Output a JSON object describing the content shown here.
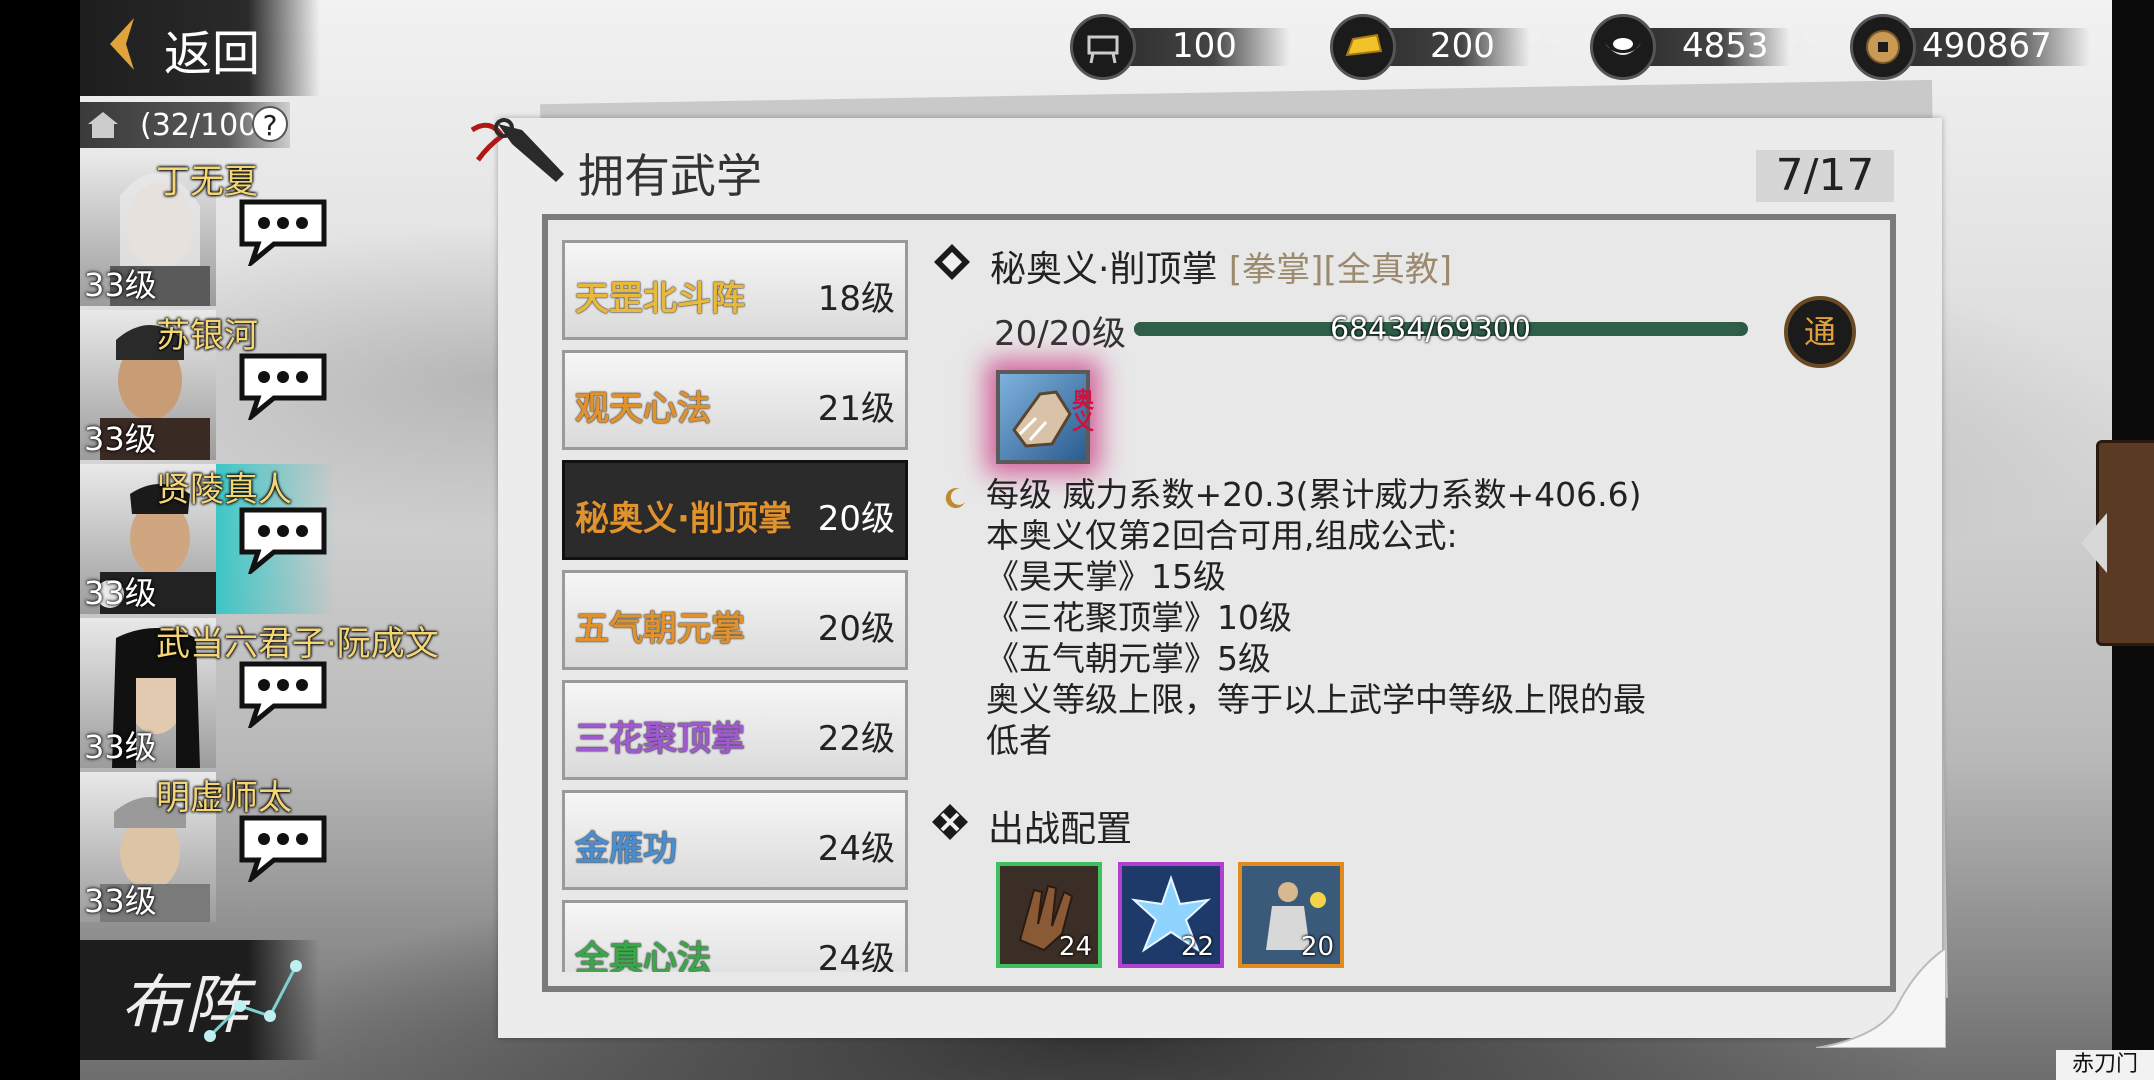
{
  "top": {
    "back_label": "返回",
    "resources": [
      {
        "icon": "cart-icon",
        "value": "100",
        "has_plus": false
      },
      {
        "icon": "gold-ingot-icon",
        "value": "200",
        "has_plus": true
      },
      {
        "icon": "silver-ingot-icon",
        "value": "4853",
        "has_plus": true
      },
      {
        "icon": "copper-coin-icon",
        "value": "490867",
        "has_plus": false
      }
    ]
  },
  "roster": {
    "capacity": "(32/100",
    "heroes": [
      {
        "name": "丁无夏",
        "level": "33级",
        "active": false
      },
      {
        "name": "苏银河",
        "level": "33级",
        "active": false
      },
      {
        "name": "贤陵真人",
        "level": "33级",
        "active": true
      },
      {
        "name": "武当六君子·阮成文",
        "level": "33级",
        "active": false
      },
      {
        "name": "明虚师太",
        "level": "33级",
        "active": false
      }
    ],
    "formation_label": "布阵"
  },
  "panel": {
    "title": "拥有武学",
    "counter": "7/17"
  },
  "skills": [
    {
      "name": "天罡北斗阵",
      "level": "18级",
      "color": "#e8b93a"
    },
    {
      "name": "观天心法",
      "level": "21级",
      "color": "#e0922e"
    },
    {
      "name": "秘奥义·削顶掌",
      "level": "20级",
      "color": "#e0922e"
    },
    {
      "name": "五气朝元掌",
      "level": "20级",
      "color": "#e0922e"
    },
    {
      "name": "三花聚顶掌",
      "level": "22级",
      "color": "#a05ad0"
    },
    {
      "name": "金雁功",
      "level": "24级",
      "color": "#4a8ed0"
    },
    {
      "name": "全真心法",
      "level": "24级",
      "color": "#3aa84a"
    }
  ],
  "detail": {
    "name": "秘奥义·削顶掌",
    "tag1": "[拳掌]",
    "tag2": "[全真教]",
    "level_text": "20/20级",
    "xp_text": "68434/69300",
    "xp_fraction": 0.9875,
    "seal_char": "通",
    "icon_badge": "奥义",
    "lines": [
      "每级  威力系数+20.3(累计威力系数+406.6)",
      "本奥义仅第2回合可用,组成公式:",
      "《昊天掌》15级",
      "《三花聚顶掌》10级",
      "《五气朝元掌》5级",
      "奥义等级上限，等于以上武学中等级上限的最",
      "低者"
    ],
    "loadout_label": "出战配置",
    "loadout": [
      {
        "value": "24",
        "border": "#3fbf5f"
      },
      {
        "value": "22",
        "border": "#b040d0"
      },
      {
        "value": "20",
        "border": "#e08a20"
      }
    ]
  },
  "footer": {
    "sect": "赤刀门"
  }
}
